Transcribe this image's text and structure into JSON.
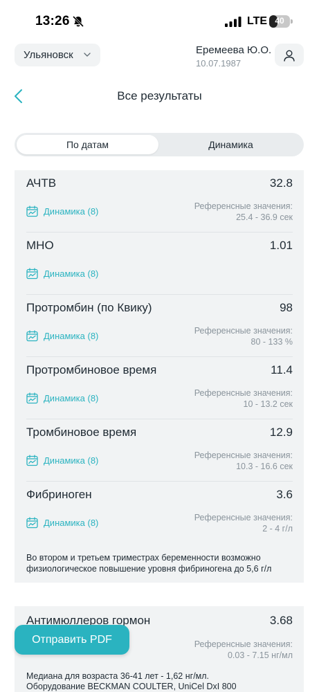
{
  "status": {
    "time": "13:26",
    "network": "LTE",
    "battery": "40",
    "battery_level": 0.4
  },
  "header": {
    "city": "Ульяновск",
    "user_name": "Еремеева Ю.О.",
    "user_dob": "10.07.1987",
    "title": "Все результаты"
  },
  "tabs": {
    "by_date": "По датам",
    "dynamics": "Динамика"
  },
  "results": [
    {
      "name": "АЧТВ",
      "value": "32.8",
      "dynamics": "Динамика (8)",
      "ref_title": "Референсные значения:",
      "ref_range": "25.4 - 36.9 сек"
    },
    {
      "name": "МНО",
      "value": "1.01",
      "dynamics": "Динамика (8)",
      "ref_title": "",
      "ref_range": ""
    },
    {
      "name": "Протромбин (по Квику)",
      "value": "98",
      "dynamics": "Динамика (8)",
      "ref_title": "Референсные значения:",
      "ref_range": "80 - 133 %"
    },
    {
      "name": "Протромбиновое время",
      "value": "11.4",
      "dynamics": "Динамика (8)",
      "ref_title": "Референсные значения:",
      "ref_range": "10 - 13.2 сек"
    },
    {
      "name": "Тромбиновое время",
      "value": "12.9",
      "dynamics": "Динамика (8)",
      "ref_title": "Референсные значения:",
      "ref_range": "10.3 - 16.6 сек"
    },
    {
      "name": "Фибриноген",
      "value": "3.6",
      "dynamics": "Динамика (8)",
      "ref_title": "Референсные значения:",
      "ref_range": "2 - 4 г/л"
    }
  ],
  "fibrinogen_note": "Во втором и третьем триместрах беременности возможно физиологическое повышение уровня фибриногена до 5,6 г/л",
  "second_card": {
    "name": "Антимюллеров гормон",
    "value": "3.68",
    "ref_title": "Референсные значения:",
    "ref_range": "0.03 - 7.15 нг/мл",
    "note_line1": "Медиана для возраста 36-41 лет - 1,62 нг/мл.",
    "note_line2": "Оборудование BECKMAN COULTER, UniCel DxI 800"
  },
  "actions": {
    "send_pdf": "Отправить PDF"
  },
  "colors": {
    "accent": "#2ab3c0",
    "card_bg": "#f1f3f4",
    "muted_text": "#8a949c"
  },
  "icons": {
    "mute": "bell-slash-icon",
    "signal": "signal-bars-icon",
    "chevron": "chevron-down-icon",
    "profile": "user-icon",
    "back": "chevron-left-icon",
    "dynamics": "chart-calendar-icon"
  }
}
